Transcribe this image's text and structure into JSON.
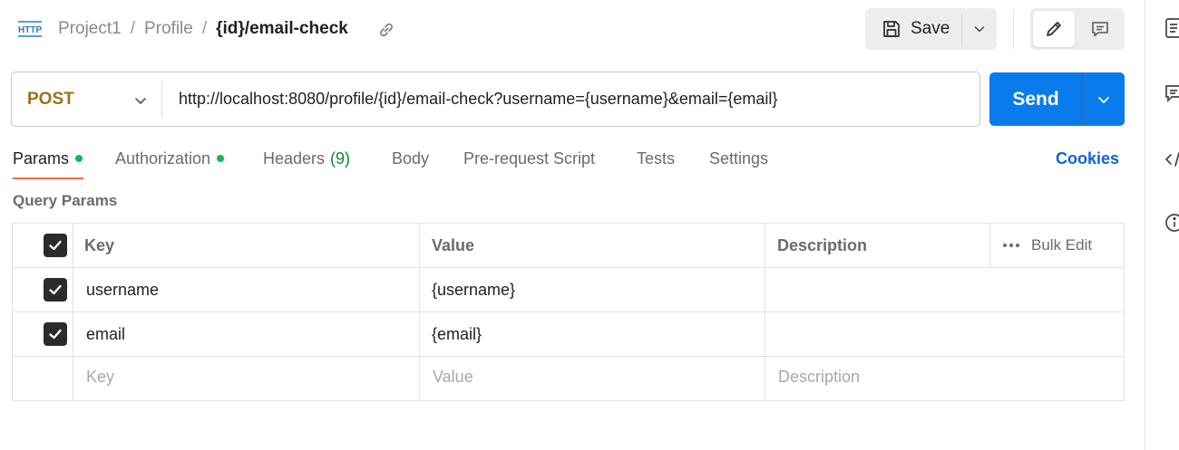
{
  "colors": {
    "method_post": "#9a7413",
    "send_button": "#097bed",
    "active_dot": "#0cbb52",
    "tab_underline": "#ff6c37",
    "cookies_link": "#0b63d6",
    "headers_count": "#0b8a3a"
  },
  "header": {
    "icon": "http-icon",
    "breadcrumb": [
      "Project1",
      "Profile",
      "{id}/email-check"
    ],
    "separator": "/",
    "link_icon": "link-icon",
    "save_label": "Save"
  },
  "request": {
    "method": "POST",
    "url": "http://localhost:8080/profile/{id}/email-check?username={username}&email={email}",
    "send_label": "Send"
  },
  "tabs": [
    {
      "label": "Params",
      "active": true,
      "indicator": "green-dot"
    },
    {
      "label": "Authorization",
      "indicator": "green-dot"
    },
    {
      "label": "Headers",
      "count": "(9)"
    },
    {
      "label": "Body"
    },
    {
      "label": "Pre-request Script"
    },
    {
      "label": "Tests"
    },
    {
      "label": "Settings"
    }
  ],
  "cookies_label": "Cookies",
  "params": {
    "title": "Query Params",
    "columns": [
      "Key",
      "Value",
      "Description"
    ],
    "bulk_edit": "Bulk Edit",
    "rows": [
      {
        "checked": true,
        "key": "username",
        "value": "{username}",
        "description": ""
      },
      {
        "checked": true,
        "key": "email",
        "value": "{email}",
        "description": ""
      }
    ],
    "placeholders": {
      "key": "Key",
      "value": "Value",
      "description": "Description"
    }
  }
}
